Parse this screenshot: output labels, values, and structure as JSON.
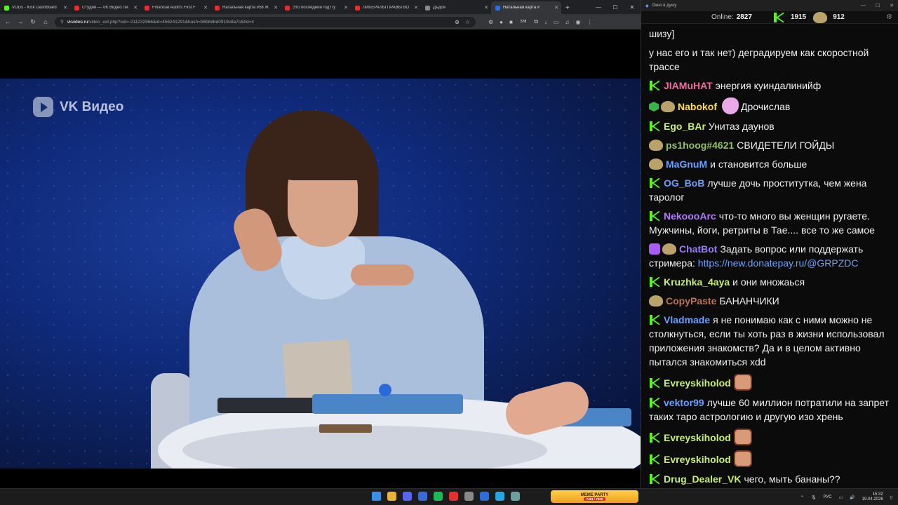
{
  "browser": {
    "tabs": [
      {
        "title": "VODs - Kick Dashboard",
        "fav": "#53fc18"
      },
      {
        "title": "Студия — VK Видео Ли",
        "fav": "#e03030"
      },
      {
        "title": "Financial Audit's First F",
        "fav": "#e03030"
      },
      {
        "title": "Натальная карта #58 Ж",
        "fav": "#e03030"
      },
      {
        "title": "Это последний год Пу",
        "fav": "#e03030"
      },
      {
        "title": "ЛИБЕРАЛЫ ПРАВЫ ВО",
        "fav": "#e03030"
      },
      {
        "title": "Дъдоя",
        "fav": "#888888"
      },
      {
        "title": "Натальная карта #",
        "fav": "#2a6fdb",
        "active": true
      }
    ],
    "new_tab": "+",
    "tab_search": "⌄",
    "window_controls": [
      "—",
      "☐",
      "✕"
    ],
    "url_host": "vkvideo.ru",
    "url_rest": "/video_ext.php?oid=-211232966&id=456241291&hash=b6b6dbd0919c8a7c&hd=4",
    "ext_badge": "578"
  },
  "video": {
    "logo_text": "VK Видео"
  },
  "chat": {
    "window_title": "Окно в душу",
    "online_label": "Online:",
    "online_value": "2827",
    "stat_kick": "1915",
    "stat_vk": "912",
    "messages": [
      {
        "text": "шизу]",
        "partial": true
      },
      {
        "text": "у нас его и так нет) деградируем как скоростной трассе"
      },
      {
        "badges": [
          "kick"
        ],
        "user": "JIAMuHAT",
        "color": "#f06aa0",
        "text": "энергия куиндалинийф"
      },
      {
        "badges": [
          "hex",
          "emote"
        ],
        "user": "Nabokof",
        "color": "#ffe040",
        "pony": true,
        "text": "Дрочислав"
      },
      {
        "badges": [
          "kick"
        ],
        "user": "Ego_BAr",
        "color": "#c8f070",
        "text": "Унитаз даунов"
      },
      {
        "badges": [
          "emote"
        ],
        "user": "ps1hoog#4621",
        "color": "#90c060",
        "text": "СВИДЕТЕЛИ ГОЙДЫ"
      },
      {
        "badges": [
          "emote"
        ],
        "user": "MaGnuM",
        "color": "#6aa0ff",
        "text": "и становится больше"
      },
      {
        "badges": [
          "kick"
        ],
        "user": "OG_BoB",
        "color": "#6aa0ff",
        "text": "лучше дочь проститутка, чем жена таролог"
      },
      {
        "badges": [
          "kick"
        ],
        "user": "NekoooArc",
        "color": "#b07aff",
        "text": "что-то много вы женщин ругаете. Мужчины, йоги, ретриты в Тае.... все то же самое"
      },
      {
        "badges": [
          "bot",
          "emote"
        ],
        "user": "ChatBot",
        "color": "#9a7cff",
        "text": "Задать вопрос или поддержать стримера:",
        "link": "https://new.donatepay.ru/@GRPZDC"
      },
      {
        "badges": [
          "kick"
        ],
        "user": "Kruzhka_4aya",
        "color": "#c8f070",
        "text": "и они множаься"
      },
      {
        "badges": [
          "emote"
        ],
        "user": "CopyPaste",
        "color": "#c07050",
        "text": "БАНАНЧИКИ"
      },
      {
        "badges": [
          "kick"
        ],
        "user": "Vladmade",
        "color": "#6aa0ff",
        "text": "я не понимаю как с ними можно не столкнуться, если ты хоть раз в жизни использовал приложения знакомств? Да и в целом активно пытался знакомиться xdd"
      },
      {
        "badges": [
          "kick"
        ],
        "user": "Evreyskiholod",
        "color": "#c8f070",
        "emote": true,
        "text": ""
      },
      {
        "badges": [
          "kick"
        ],
        "user": "vektor99",
        "color": "#6aa0ff",
        "text": "лучше 60 миллион потратили на запрет таких таро астрологию и другую изо хрень"
      },
      {
        "badges": [
          "kick"
        ],
        "user": "Evreyskiholod",
        "color": "#c8f070",
        "emote": true,
        "text": ""
      },
      {
        "badges": [
          "kick"
        ],
        "user": "Evreyskiholod",
        "color": "#c8f070",
        "emote": true,
        "text": ""
      },
      {
        "badges": [
          "kick"
        ],
        "user": "Drug_Dealer_VK",
        "color": "#c8f070",
        "text": "чего, мыть бананы??"
      }
    ]
  },
  "taskbar": {
    "meme_title": "MEME PARTY",
    "meme_sub": "7481 / 7500",
    "lang": "РУС",
    "time": "15:32",
    "date": "19.04.2026",
    "icon_colors": [
      "#3a8ee6",
      "#e8b43a",
      "#5865f2",
      "#3a6ad6",
      "#1db954",
      "#e03030",
      "#888888",
      "#2a6fdb",
      "#26a5e4",
      "#6aa0a0"
    ]
  }
}
